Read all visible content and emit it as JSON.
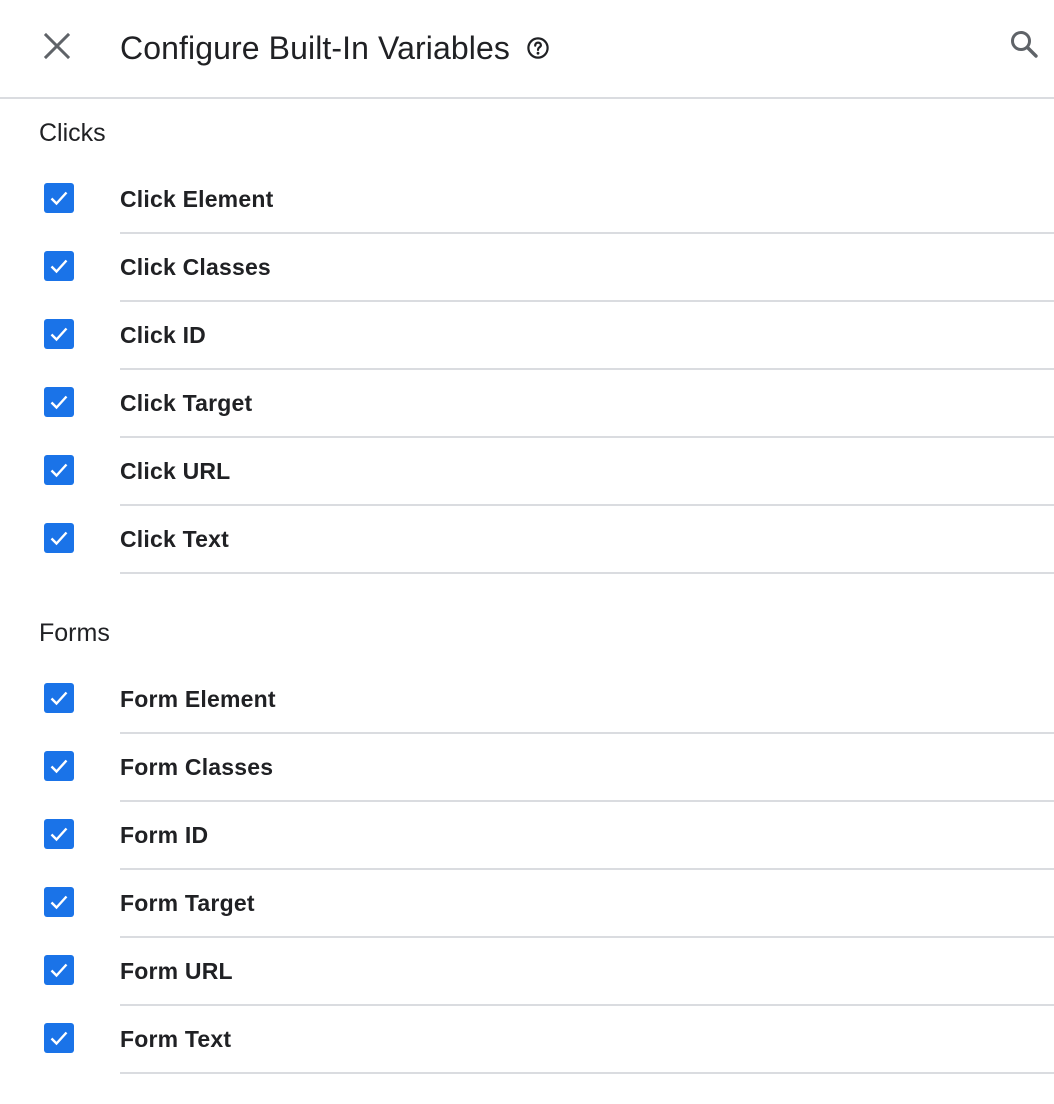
{
  "header": {
    "title": "Configure Built-In Variables",
    "close_icon": "close-icon",
    "help_icon": "help-circle-icon",
    "search_icon": "search-icon"
  },
  "colors": {
    "checkbox_checked": "#1a73e8",
    "divider": "#dadce0",
    "text": "#202124",
    "icon": "#5f6368"
  },
  "sections": [
    {
      "title": "Clicks",
      "items": [
        {
          "label": "Click Element",
          "checked": true
        },
        {
          "label": "Click Classes",
          "checked": true
        },
        {
          "label": "Click ID",
          "checked": true
        },
        {
          "label": "Click Target",
          "checked": true
        },
        {
          "label": "Click URL",
          "checked": true
        },
        {
          "label": "Click Text",
          "checked": true
        }
      ]
    },
    {
      "title": "Forms",
      "items": [
        {
          "label": "Form Element",
          "checked": true
        },
        {
          "label": "Form Classes",
          "checked": true
        },
        {
          "label": "Form ID",
          "checked": true
        },
        {
          "label": "Form Target",
          "checked": true
        },
        {
          "label": "Form URL",
          "checked": true
        },
        {
          "label": "Form Text",
          "checked": true
        }
      ]
    }
  ]
}
